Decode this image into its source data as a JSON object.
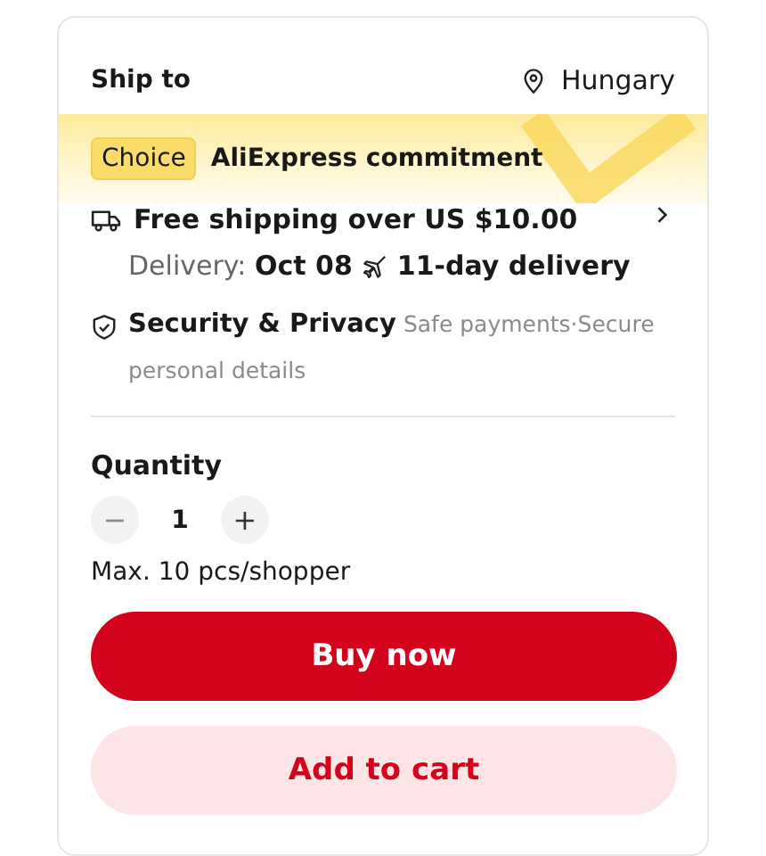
{
  "ship_to": {
    "label": "Ship to",
    "country": "Hungary"
  },
  "choice_banner": {
    "badge": "Choice",
    "text": "AliExpress commitment"
  },
  "shipping": {
    "title": "Free shipping over US $10.00",
    "delivery": "Delivery: **Oct 08**",
    "delivery_speed": "11-day delivery"
  },
  "security": {
    "text": "**Security & Privacy** Safe payments·Secure personal details"
  },
  "quantity": {
    "label": "Quantity",
    "value": "1",
    "decrease": {
      "symbol": "−",
      "disabled": true
    },
    "increase": {
      "symbol": "+",
      "disabled": false
    },
    "limit": "Max. 10 pcs/shopper"
  },
  "buttons": [
    {
      "kind": "primary",
      "label": "Buy now"
    },
    {
      "kind": "secondary",
      "label": "Add to cart"
    }
  ]
}
